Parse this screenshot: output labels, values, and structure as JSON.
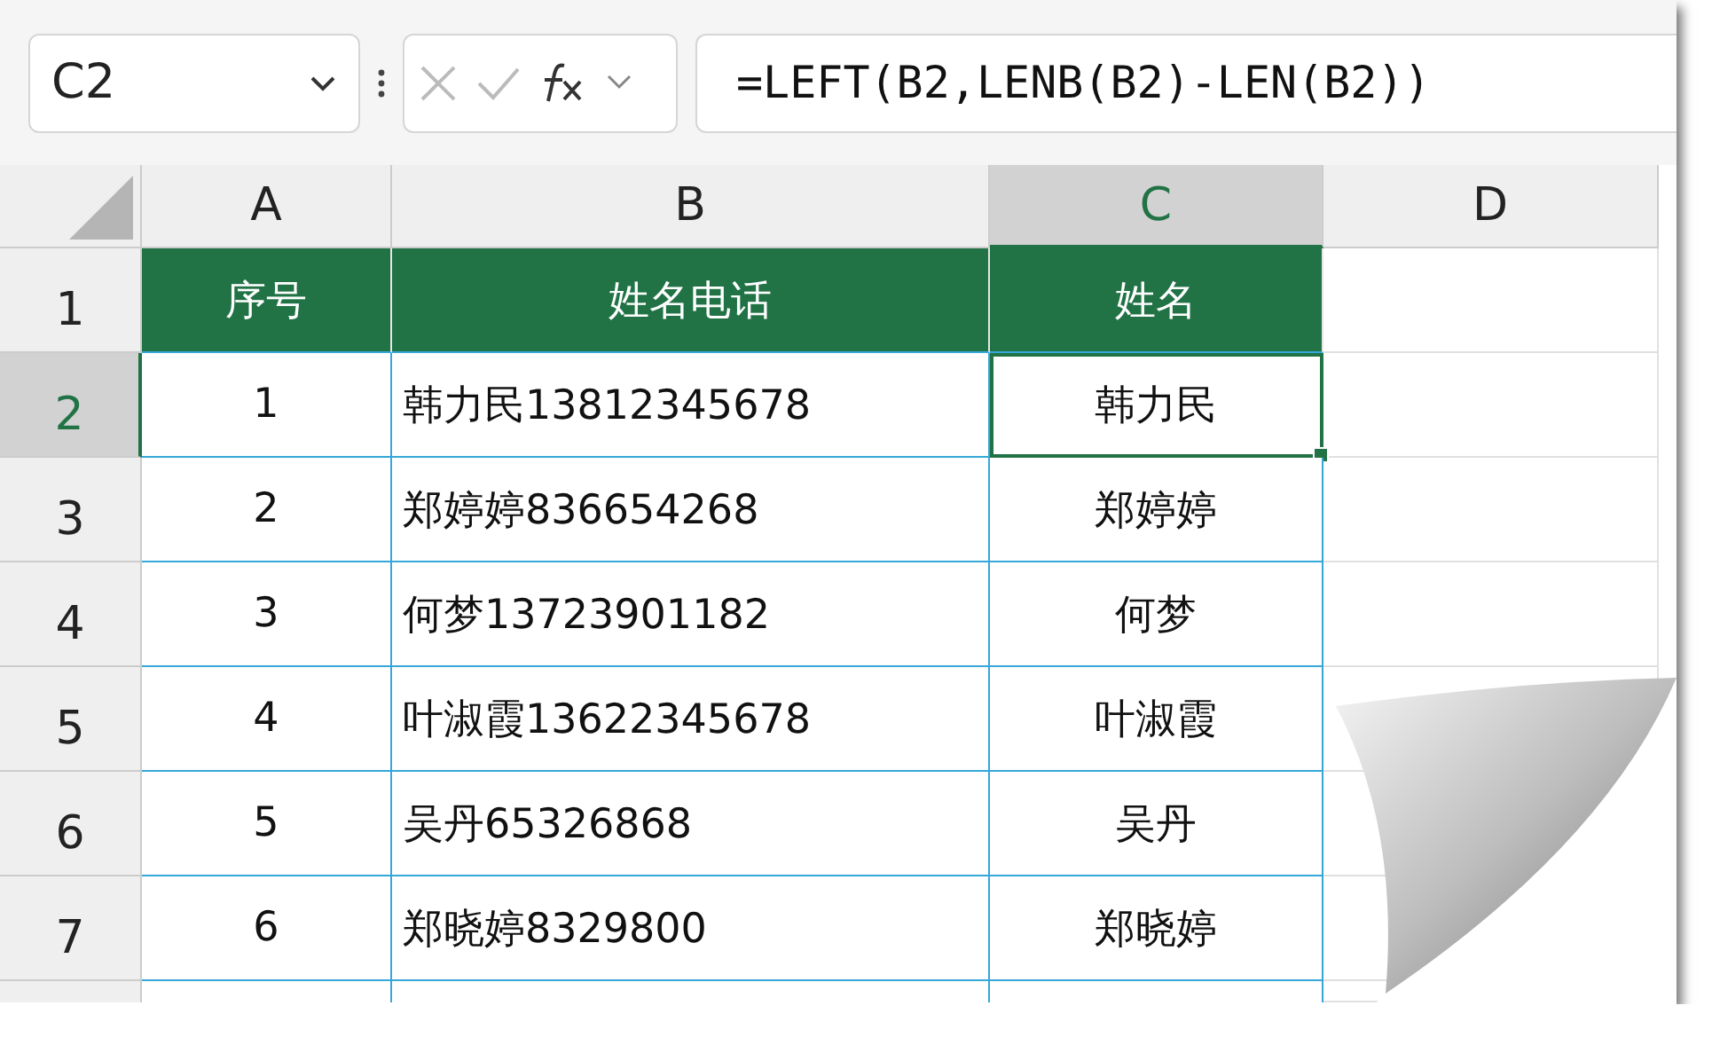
{
  "name_box": {
    "value": "C2"
  },
  "formula_bar": {
    "value": "=LEFT(B2,LENB(B2)-LEN(B2))"
  },
  "columns": [
    {
      "label": "A",
      "selected": false
    },
    {
      "label": "B",
      "selected": false
    },
    {
      "label": "C",
      "selected": true
    },
    {
      "label": "D",
      "selected": false
    }
  ],
  "rows": [
    {
      "number": "1",
      "kind": "header",
      "selected": false,
      "cells": [
        {
          "value": "序号",
          "selected": false
        },
        {
          "value": "姓名电话",
          "selected": false
        },
        {
          "value": "姓名",
          "selected": false
        }
      ]
    },
    {
      "number": "2",
      "kind": "data",
      "selected": true,
      "cells": [
        {
          "value": "1",
          "selected": false
        },
        {
          "value": "韩力民13812345678",
          "selected": false
        },
        {
          "value": "韩力民",
          "selected": true
        }
      ]
    },
    {
      "number": "3",
      "kind": "data",
      "selected": false,
      "cells": [
        {
          "value": "2",
          "selected": false
        },
        {
          "value": "郑婷婷836654268",
          "selected": false
        },
        {
          "value": "郑婷婷",
          "selected": false
        }
      ]
    },
    {
      "number": "4",
      "kind": "data",
      "selected": false,
      "cells": [
        {
          "value": "3",
          "selected": false
        },
        {
          "value": "何梦13723901182",
          "selected": false
        },
        {
          "value": "何梦",
          "selected": false
        }
      ]
    },
    {
      "number": "5",
      "kind": "data",
      "selected": false,
      "cells": [
        {
          "value": "4",
          "selected": false
        },
        {
          "value": "叶淑霞13622345678",
          "selected": false
        },
        {
          "value": "叶淑霞",
          "selected": false
        }
      ]
    },
    {
      "number": "6",
      "kind": "data",
      "selected": false,
      "cells": [
        {
          "value": "5",
          "selected": false
        },
        {
          "value": "吴丹65326868",
          "selected": false
        },
        {
          "value": "吴丹",
          "selected": false
        }
      ]
    },
    {
      "number": "7",
      "kind": "data",
      "selected": false,
      "cells": [
        {
          "value": "6",
          "selected": false
        },
        {
          "value": "郑晓婷8329800",
          "selected": false
        },
        {
          "value": "郑晓婷",
          "selected": false
        }
      ]
    }
  ]
}
